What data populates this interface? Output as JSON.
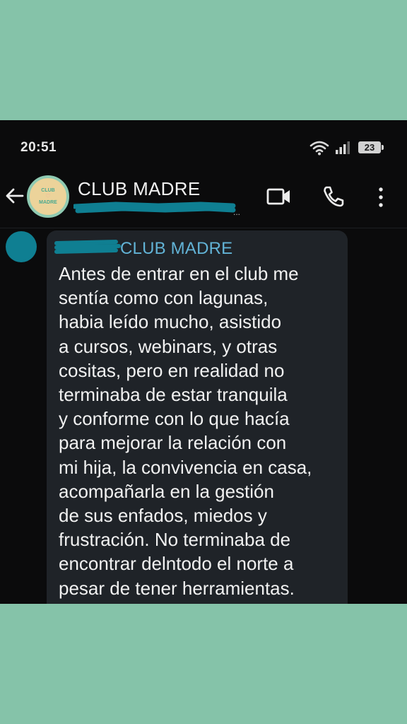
{
  "status_bar": {
    "time": "20:51",
    "battery": "23",
    "icons": [
      "wifi-icon",
      "signal-icon",
      "battery-icon"
    ]
  },
  "header": {
    "title": "CLUB MADRE",
    "participants_ellipsis": "...",
    "avatar_logo": {
      "top": "CLUB",
      "middle": "♡",
      "bottom": "MADRE"
    },
    "icons": [
      "back-arrow-icon",
      "video-call-icon",
      "phone-call-icon",
      "more-options-icon"
    ]
  },
  "message": {
    "sender_group": "CLUB MADRE",
    "text": "Antes de entrar en el club me\nsentía como con lagunas,\nhabia leído mucho, asistido\na cursos, webinars, y otras\ncositas, pero en realidad no\nterminaba de estar tranquila\ny conforme con lo que hacía\npara mejorar la relación con\nmi hija, la convivencia en casa,\nacompañarla en la gestión\nde sus enfados, miedos y\nfrustración. No terminaba de\nencontrar delntodo el norte a\npesar de tener herramientas."
  },
  "colors": {
    "background": "#85c3a9",
    "screen": "#0b0b0c",
    "bubble": "#1f2328",
    "sender_name": "#62b3d6",
    "redaction": "#0f7f92"
  }
}
